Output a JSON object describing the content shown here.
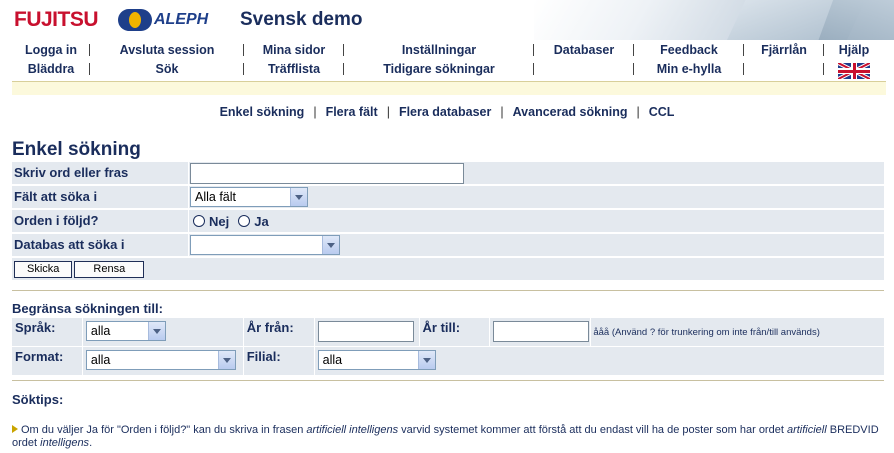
{
  "header": {
    "brand_logo": "FUJITSU",
    "aleph_logo": "ALEPH",
    "title": "Svensk demo"
  },
  "nav": {
    "row1": [
      "Logga in",
      "Avsluta session",
      "Mina sidor",
      "Inställningar",
      "Databaser",
      "Feedback",
      "Fjärrlån",
      "Hjälp"
    ],
    "row2": [
      "Bläddra",
      "Sök",
      "Träfflista",
      "Tidigare sökningar",
      "",
      "Min e-hylla",
      "",
      ""
    ],
    "language_flag": "uk-flag-icon"
  },
  "subtabs": [
    "Enkel sökning",
    "Flera fält",
    "Flera databaser",
    "Avancerad sökning",
    "CCL"
  ],
  "page_title": "Enkel sökning",
  "form": {
    "search_label": "Skriv ord eller fras",
    "search_value": "",
    "field_label": "Fält att söka i",
    "field_value": "Alla fält",
    "order_label": "Orden i följd?",
    "order_no": "Nej",
    "order_yes": "Ja",
    "db_label": "Databas att söka i",
    "db_value": "",
    "submit_button": "Skicka",
    "reset_button": "Rensa"
  },
  "limit": {
    "title": "Begränsa sökningen till:",
    "language_label": "Språk:",
    "language_value": "alla",
    "year_from_label": "År från:",
    "year_from_value": "",
    "year_to_label": "År till:",
    "year_to_value": "",
    "year_hint": "ååå (Använd ? för trunkering om inte från/till används)",
    "format_label": "Format:",
    "format_value": "alla",
    "branch_label": "Filial:",
    "branch_value": "alla"
  },
  "tips": {
    "title": "Söktips:",
    "t1": "Om du väljer Ja för \"Orden i följd?\" kan du skriva in frasen ",
    "t2": "artificiell intelligens",
    "t3": " varvid systemet kommer att förstå att du endast vill ha de poster som har ordet ",
    "t4": "artificiell",
    "t5": " BREDVID ordet ",
    "t6": "intelligens",
    "t7": "."
  },
  "colors": {
    "accent_text": "#1a2d5c",
    "brand_red": "#c8102e",
    "form_bg": "#e4e9ef",
    "notice_bar": "#fcf9dc"
  }
}
